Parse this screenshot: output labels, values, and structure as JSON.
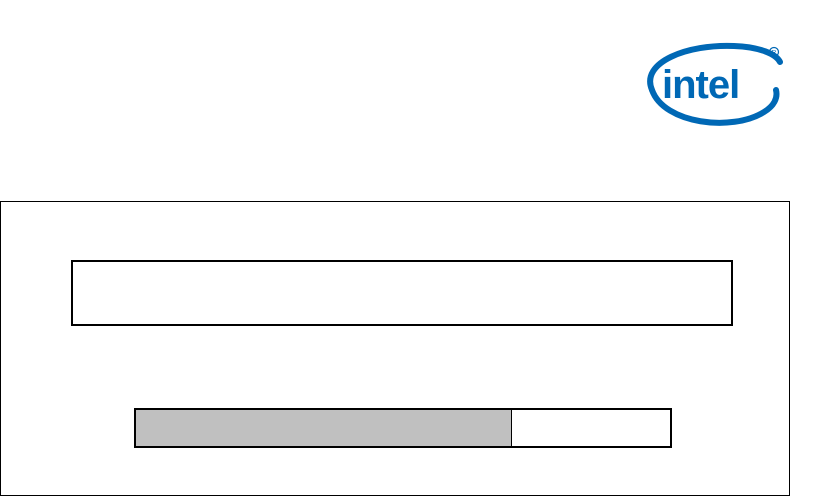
{
  "branding": {
    "logo": "intel-logo",
    "logo_text": "intel",
    "logo_color": "#0068b5"
  },
  "status": {
    "message": ""
  },
  "progress": {
    "fraction": 0.705,
    "fill_color": "#c0c0c0",
    "track_color": "#ffffff"
  }
}
